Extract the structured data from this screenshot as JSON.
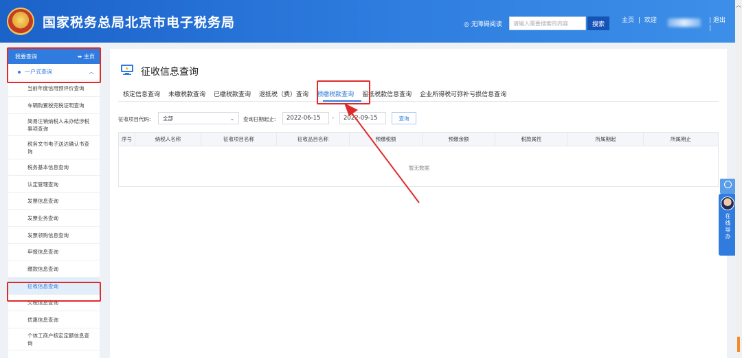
{
  "header": {
    "site_title": "国家税务总局北京市电子税务局",
    "accessibility_label": "无障碍阅读",
    "search_placeholder": "请输入需要搜索的内容",
    "search_button": "搜索",
    "home_link": "主页",
    "welcome_text": "欢迎",
    "logout_link": "退出"
  },
  "sidebar": {
    "head_title": "我要查询",
    "home_label": "主页",
    "group_label": "一户式查询",
    "items": [
      {
        "label": "当前年度信用预评价查询"
      },
      {
        "label": "车辆购置税完税证明查询"
      },
      {
        "label": "简易注销纳税人未办结涉税事项查询"
      },
      {
        "label": "税务文书电子送达确认书查询"
      },
      {
        "label": "税务基本信息查询"
      },
      {
        "label": "认定管理查询"
      },
      {
        "label": "发票信息查询"
      },
      {
        "label": "发票业务查询"
      },
      {
        "label": "发票领购信息查询"
      },
      {
        "label": "申报信息查询"
      },
      {
        "label": "缴款信息查询"
      },
      {
        "label": "征收信息查询"
      },
      {
        "label": "欠税信息查询"
      },
      {
        "label": "优惠信息查询"
      },
      {
        "label": "个体工商户核定定额信息查询"
      }
    ]
  },
  "main": {
    "title": "征收信息查询",
    "tabs": [
      {
        "label": "核定信息查询"
      },
      {
        "label": "未缴税款查询"
      },
      {
        "label": "已缴税款查询"
      },
      {
        "label": "退抵税（费）查询"
      },
      {
        "label": "预缴税款查询"
      },
      {
        "label": "留抵税款信息查询"
      },
      {
        "label": "企业所得税可弥补亏损信息查询"
      }
    ],
    "filters": {
      "item_code_label": "征收项目代码:",
      "item_code_value": "全部",
      "date_label": "查询日期起止:",
      "date_start": "2022-06-15",
      "date_sep": "-",
      "date_end": "2022-09-15",
      "query_button": "查询"
    },
    "table": {
      "columns": [
        "序号",
        "纳税人名称",
        "征收项目名称",
        "征收品目名称",
        "预缴税额",
        "预缴余额",
        "税款属性",
        "所属期起",
        "所属期止"
      ],
      "empty_text": "暂无数据"
    }
  },
  "widgets": {
    "online_help": "在线导办"
  },
  "colors": {
    "header_blue": "#2f7ee0",
    "accent_blue": "#2f7bde",
    "highlight_red": "#e02a2a"
  }
}
